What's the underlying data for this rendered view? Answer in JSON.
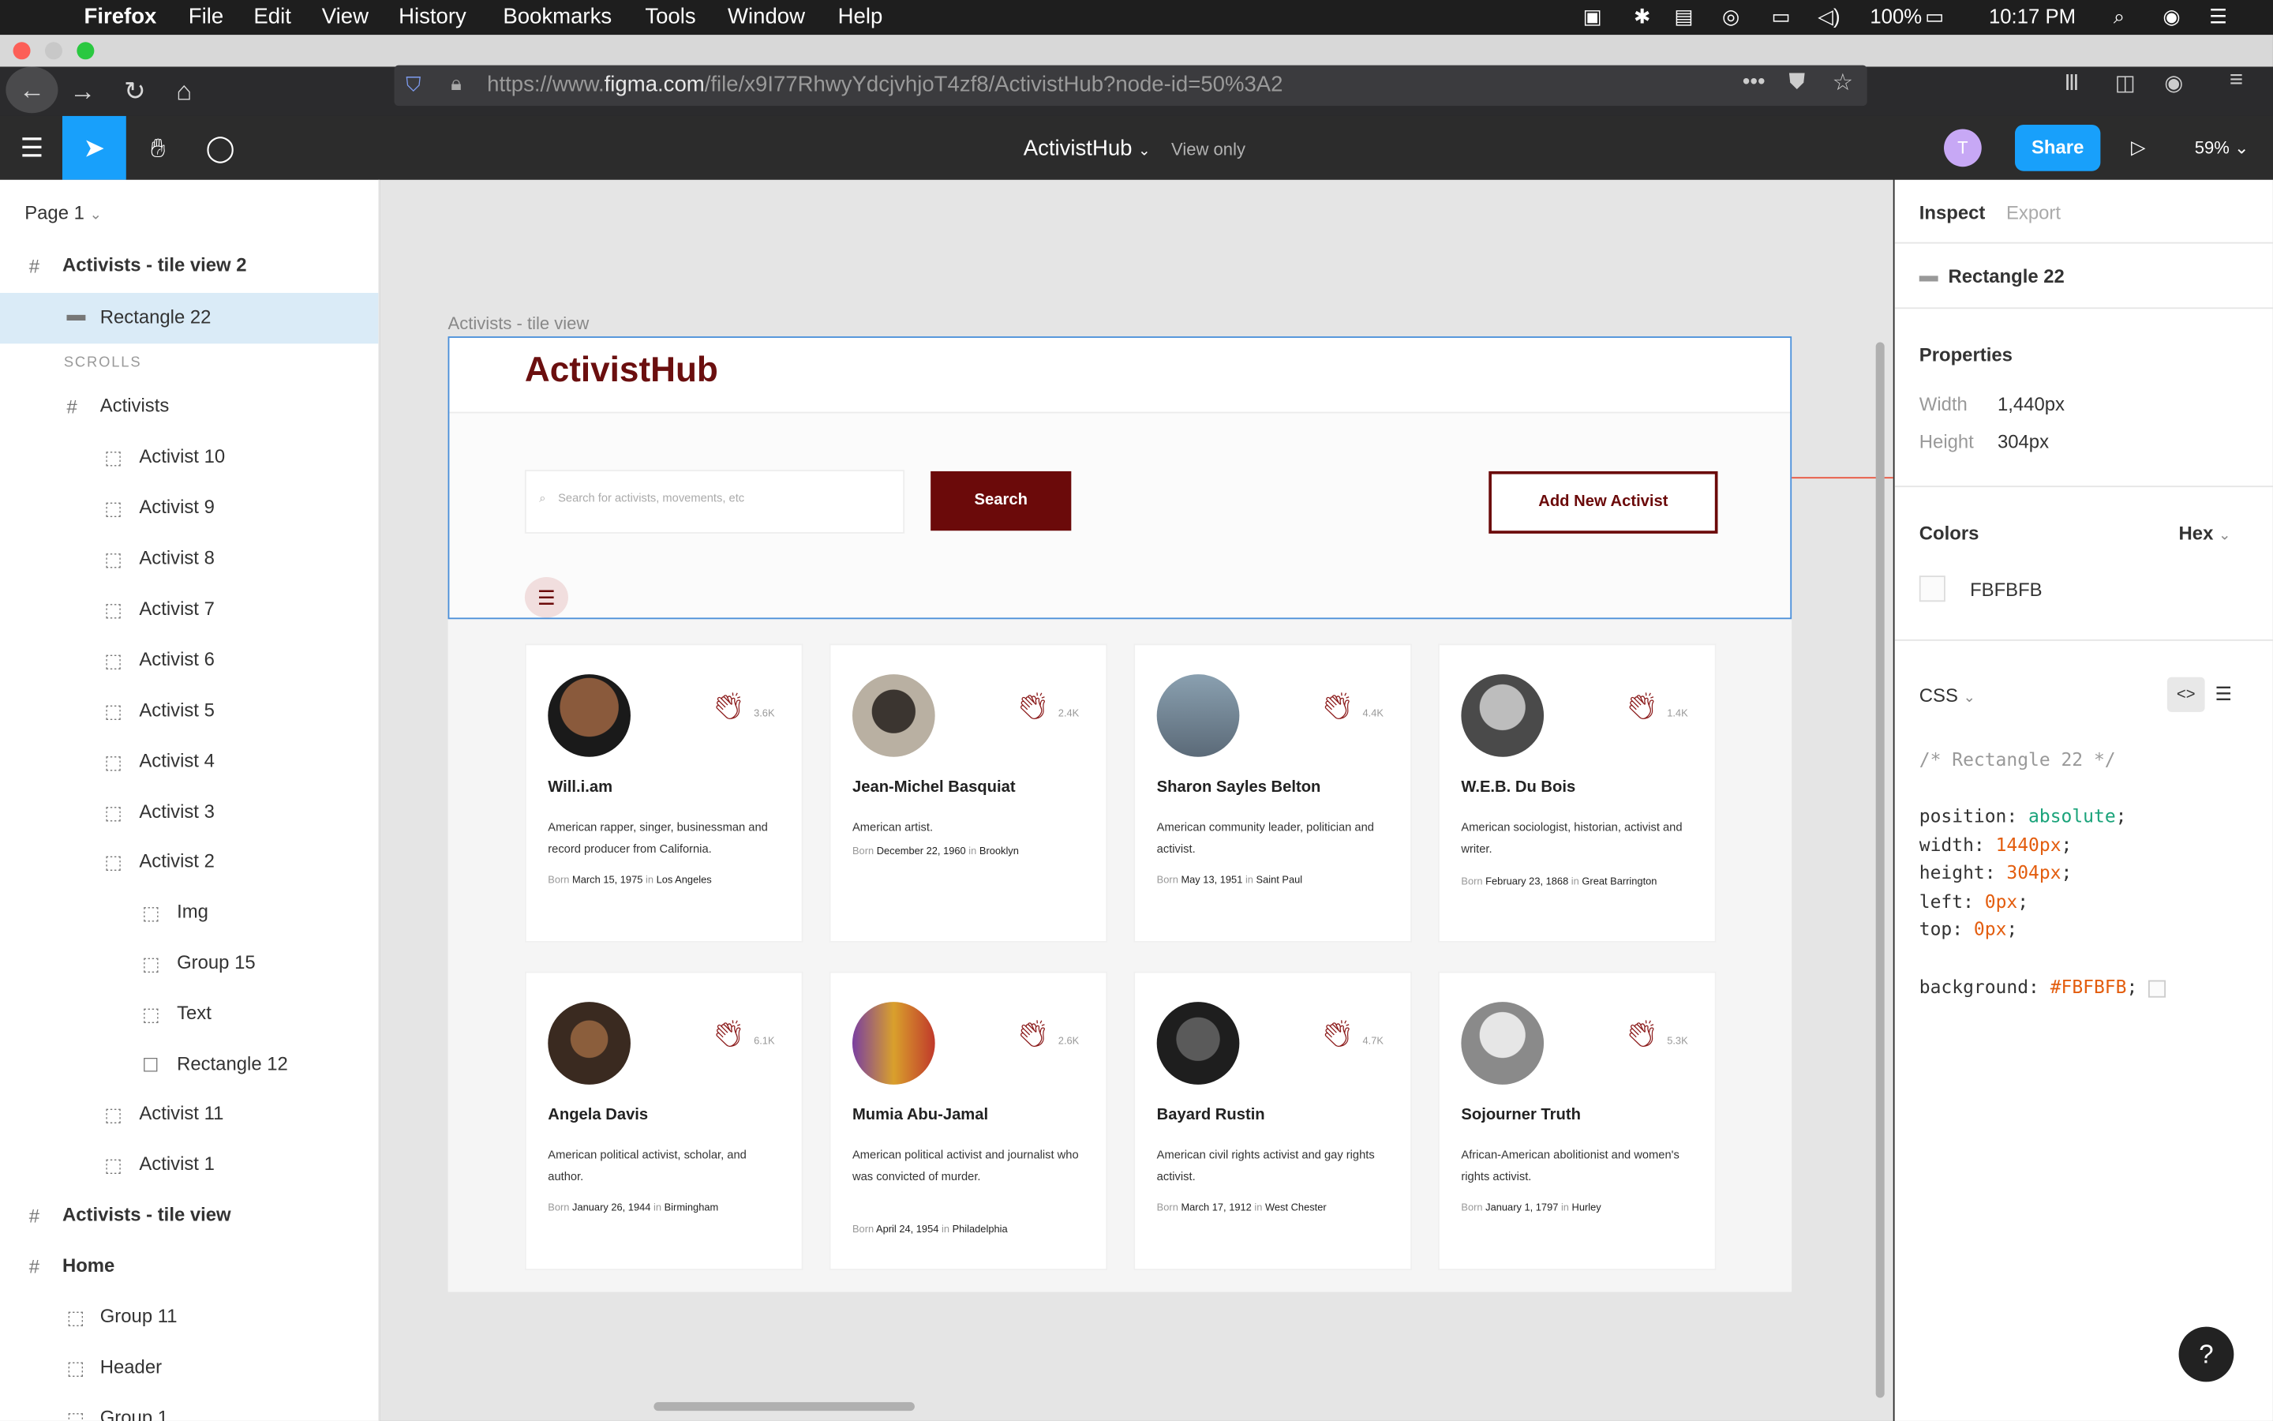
{
  "menubar": {
    "app": "Firefox",
    "items": [
      "File",
      "Edit",
      "View",
      "History",
      "Bookmarks",
      "Tools",
      "Window",
      "Help"
    ],
    "battery": "100%",
    "time": "10:17 PM"
  },
  "browser": {
    "url_prefix": "https://www.",
    "url_domain": "figma.com",
    "url_path": "/file/x9I77RhwyYdcjvhjoT4zf8/ActivistHub?node-id=50%3A2"
  },
  "figma": {
    "doc_title": "ActivistHub",
    "view_mode": "View only",
    "avatar_initial": "T",
    "share_label": "Share",
    "zoom": "59%"
  },
  "layers": {
    "page_selector": "Page 1",
    "section_scrolls": "SCROLLS",
    "items": [
      {
        "label": "Activists - tile view 2"
      },
      {
        "label": "Rectangle 22"
      },
      {
        "label": "Activists"
      },
      {
        "label": "Activist 10"
      },
      {
        "label": "Activist 9"
      },
      {
        "label": "Activist 8"
      },
      {
        "label": "Activist 7"
      },
      {
        "label": "Activist 6"
      },
      {
        "label": "Activist 5"
      },
      {
        "label": "Activist 4"
      },
      {
        "label": "Activist 3"
      },
      {
        "label": "Activist 2"
      },
      {
        "label": "Img"
      },
      {
        "label": "Group 15"
      },
      {
        "label": "Text"
      },
      {
        "label": "Rectangle 12"
      },
      {
        "label": "Activist 11"
      },
      {
        "label": "Activist 1"
      },
      {
        "label": "Activists - tile view"
      },
      {
        "label": "Home"
      },
      {
        "label": "Group 11"
      },
      {
        "label": "Header"
      },
      {
        "label": "Group 1"
      }
    ]
  },
  "canvas": {
    "frame_label": "Activists - tile view",
    "logo": "ActivistHub",
    "search_placeholder": "Search for activists, movements, etc",
    "search_button": "Search",
    "add_button": "Add New Activist",
    "cards": [
      {
        "name": "Will.i.am",
        "claps": "3.6K",
        "desc": "American rapper, singer, businessman and record producer from California.",
        "born_label": "Born",
        "born_date": "March 15, 1975",
        "in_label": "in",
        "born_place": "Los Angeles"
      },
      {
        "name": "Jean-Michel Basquiat",
        "claps": "2.4K",
        "desc": "American artist.",
        "born_label": "Born",
        "born_date": "December 22, 1960",
        "in_label": "in",
        "born_place": "Brooklyn"
      },
      {
        "name": "Sharon Sayles Belton",
        "claps": "4.4K",
        "desc": "American community leader, politician and activist.",
        "born_label": "Born",
        "born_date": "May 13, 1951",
        "in_label": "in",
        "born_place": "Saint Paul"
      },
      {
        "name": "W.E.B. Du Bois",
        "claps": "1.4K",
        "desc": "American sociologist, historian, activist and writer.",
        "born_label": "Born",
        "born_date": "February 23, 1868",
        "in_label": "in",
        "born_place": "Great Barrington"
      },
      {
        "name": "Angela Davis",
        "claps": "6.1K",
        "desc": "American political activist, scholar, and author.",
        "born_label": "Born",
        "born_date": "January 26, 1944",
        "in_label": "in",
        "born_place": "Birmingham"
      },
      {
        "name": "Mumia Abu-Jamal",
        "claps": "2.6K",
        "desc": "American political activist and journalist who was convicted of murder.",
        "born_label": "Born",
        "born_date": "April 24, 1954",
        "in_label": "in",
        "born_place": "Philadelphia"
      },
      {
        "name": "Bayard Rustin",
        "claps": "4.7K",
        "desc": "American civil rights activist and gay rights activist.",
        "born_label": "Born",
        "born_date": "March 17, 1912",
        "in_label": "in",
        "born_place": "West Chester"
      },
      {
        "name": "Sojourner Truth",
        "claps": "5.3K",
        "desc": "African-American abolitionist and women's rights activist.",
        "born_label": "Born",
        "born_date": "January 1, 1797",
        "in_label": "in",
        "born_place": "Hurley"
      }
    ]
  },
  "inspect": {
    "tab_inspect": "Inspect",
    "tab_export": "Export",
    "layer_name": "Rectangle 22",
    "properties_title": "Properties",
    "width_label": "Width",
    "width_value": "1,440px",
    "height_label": "Height",
    "height_value": "304px",
    "colors_title": "Colors",
    "color_format": "Hex",
    "color_value": "FBFBFB",
    "css_title": "CSS",
    "css_comment": "/* Rectangle 22 */",
    "css_lines": [
      {
        "prop": "position",
        "value": "absolute",
        "kind": "kw"
      },
      {
        "prop": "width",
        "value": "1440px",
        "kind": "num"
      },
      {
        "prop": "height",
        "value": "304px",
        "kind": "num"
      },
      {
        "prop": "left",
        "value": "0px",
        "kind": "num"
      },
      {
        "prop": "top",
        "value": "0px",
        "kind": "num"
      },
      {
        "prop": "background",
        "value": "#FBFBFB",
        "kind": "num"
      }
    ]
  },
  "colors": {
    "brand_maroon": "#6b0a0a",
    "figma_blue": "#18a0fb",
    "selection": "#daebf7",
    "header_bg": "#FBFBFB"
  }
}
